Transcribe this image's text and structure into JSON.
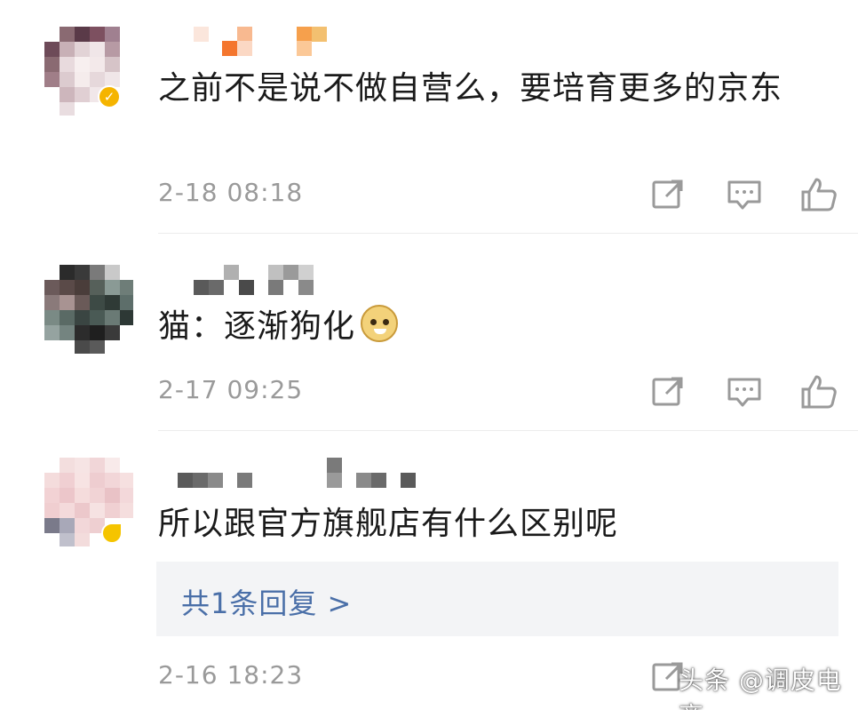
{
  "comments": [
    {
      "text": "之前不是说不做自营么，要培育更多的京东",
      "timestamp": "2-18 08:18",
      "verified": true,
      "share_icon": "share-icon",
      "reply_icon": "comment-icon",
      "like_icon": "thumbs-up-icon"
    },
    {
      "text": "猫：逐渐狗化",
      "emoji": "doge-emoji",
      "timestamp": "2-17 09:25",
      "share_icon": "share-icon",
      "reply_icon": "comment-icon",
      "like_icon": "thumbs-up-icon"
    },
    {
      "text": "所以跟官方旗舰店有什么区别呢",
      "replies_label": "共1条回复 >",
      "timestamp": "2-16 18:23",
      "share_icon": "share-icon"
    }
  ],
  "watermark": "头条 @调皮电商",
  "colors": {
    "text": "#1a1a1a",
    "timestamp": "#9a9a9a",
    "reply_link": "#4a6fa8",
    "reply_bg": "#f3f4f6",
    "verified": "#f5b400"
  }
}
